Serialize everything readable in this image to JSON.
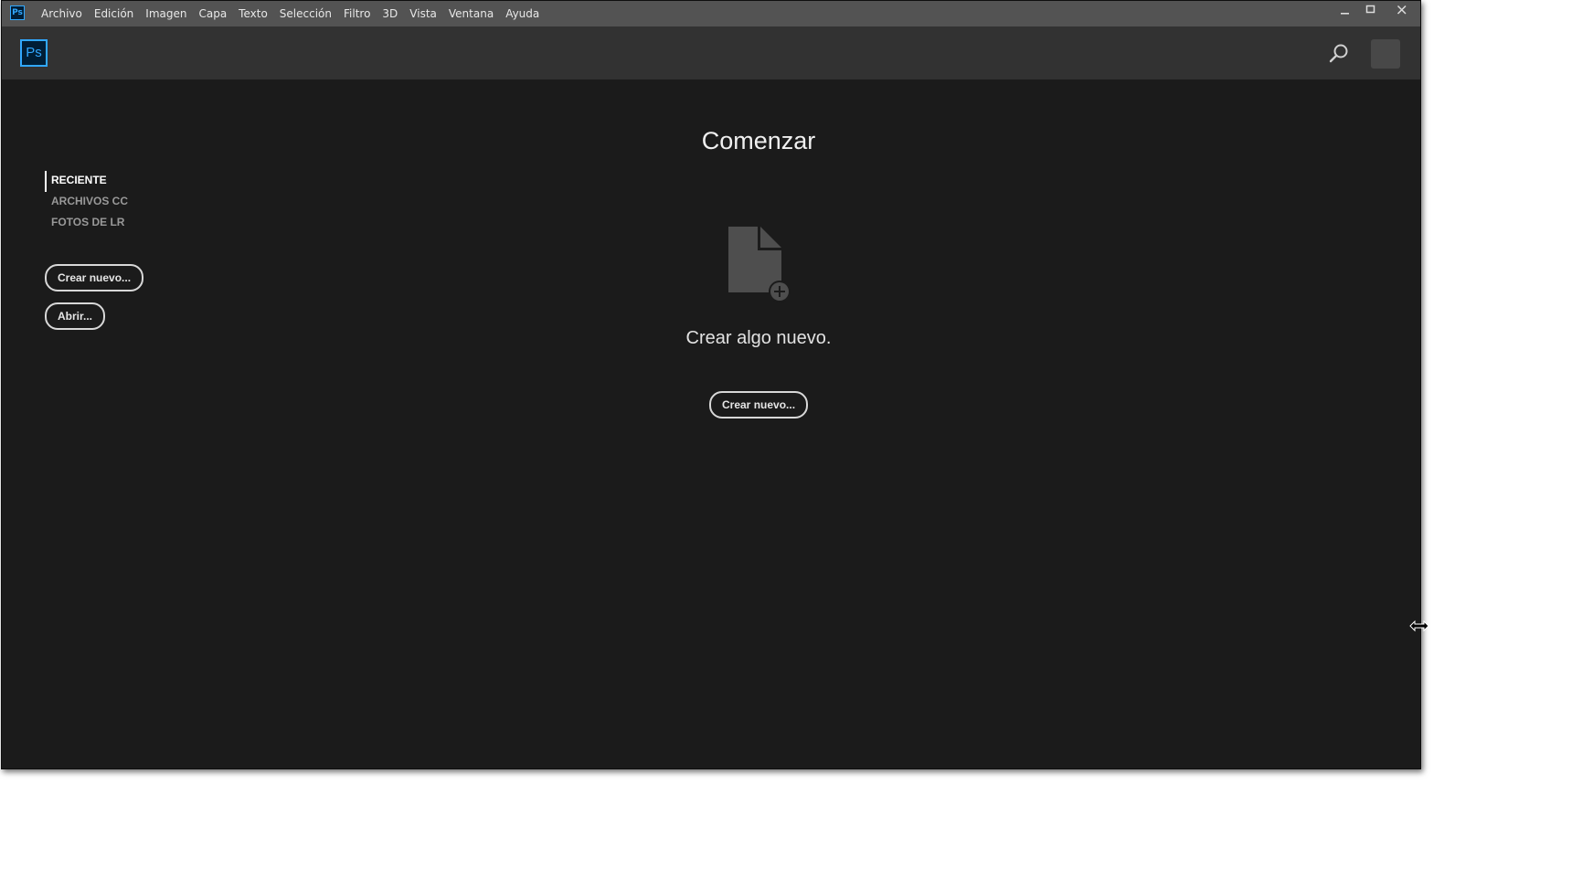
{
  "app": {
    "icon_label": "Ps",
    "logo_label": "Ps"
  },
  "menu": {
    "items": [
      "Archivo",
      "Edición",
      "Imagen",
      "Capa",
      "Texto",
      "Selección",
      "Filtro",
      "3D",
      "Vista",
      "Ventana",
      "Ayuda"
    ]
  },
  "window_controls": {
    "minimize": "—",
    "maximize": "☐",
    "close": "✕"
  },
  "header": {
    "search_icon": "search-icon",
    "avatar_icon": "avatar"
  },
  "sidebar": {
    "items": [
      {
        "label": "RECIENTE",
        "active": true
      },
      {
        "label": "ARCHIVOS CC",
        "active": false
      },
      {
        "label": "FOTOS DE LR",
        "active": false
      }
    ],
    "create_button": "Crear nuevo...",
    "open_button": "Abrir..."
  },
  "main": {
    "title": "Comenzar",
    "icon": "new-document-icon",
    "subtitle": "Crear algo nuevo.",
    "create_button": "Crear nuevo..."
  },
  "colors": {
    "background": "#1b1b1b",
    "menubar": "#535353",
    "header": "#323232",
    "accent": "#31a8ff"
  }
}
